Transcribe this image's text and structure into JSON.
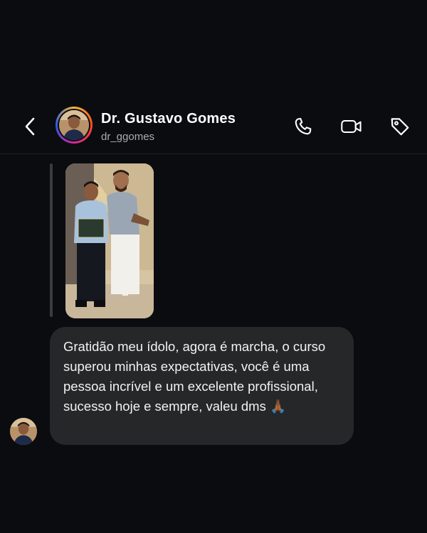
{
  "contact": {
    "name": "Dr. Gustavo Gomes",
    "handle": "dr_ggomes"
  },
  "icons": {
    "back": "chevron-left-icon",
    "call": "phone-icon",
    "video": "video-camera-icon",
    "tag": "tag-icon",
    "emoji": "🙏🏾"
  },
  "message": {
    "text": "Gratidão meu ídolo, agora é marcha, o curso superou minhas expectativas, você é uma pessoa incrível e um excelente profissional, sucesso hoje e sempre, valeu dms"
  },
  "colors": {
    "background": "#0b0c10",
    "bubble": "#262729",
    "handle": "#a8acb3"
  }
}
